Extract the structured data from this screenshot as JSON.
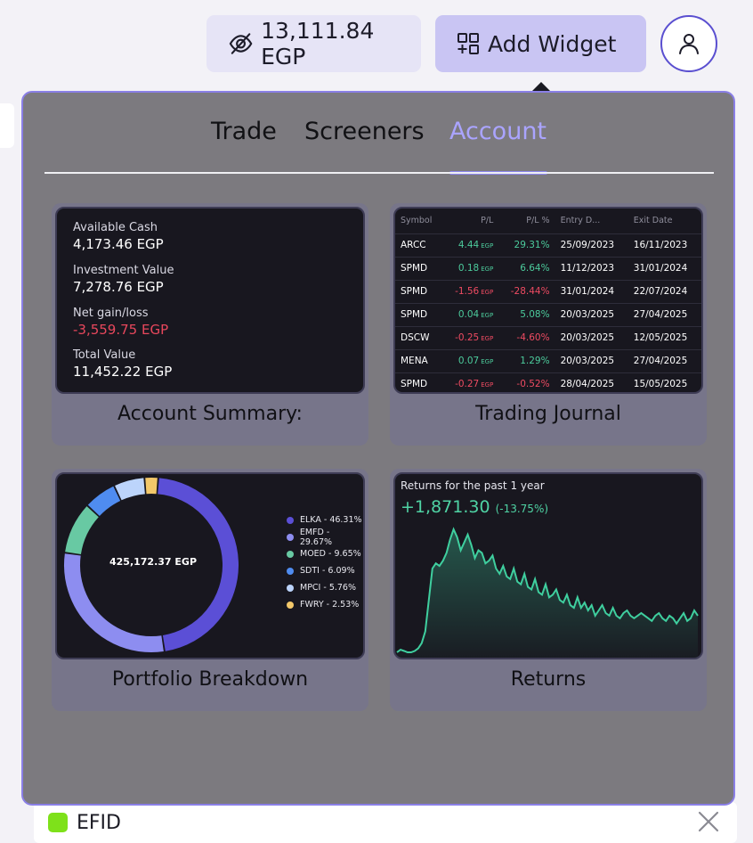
{
  "header": {
    "balance": "13,111.84 EGP",
    "add_widget_label": "Add Widget"
  },
  "tabs": [
    {
      "label": "Trade",
      "active": false
    },
    {
      "label": "Screeners",
      "active": false
    },
    {
      "label": "Account",
      "active": true
    }
  ],
  "widgets": {
    "account_summary": {
      "title": "Account Summary:",
      "rows": [
        {
          "label": "Available Cash",
          "value": "4,173.46 EGP",
          "negative": false
        },
        {
          "label": "Investment Value",
          "value": "7,278.76 EGP",
          "negative": false
        },
        {
          "label": "Net gain/loss",
          "value": "-3,559.75 EGP",
          "negative": true
        },
        {
          "label": "Total Value",
          "value": "11,452.22 EGP",
          "negative": false
        }
      ]
    },
    "trading_journal": {
      "title": "Trading Journal",
      "columns": [
        "Symbol",
        "P/L",
        "P/L %",
        "Entry D...",
        "Exit Date"
      ],
      "currency": "EGP",
      "rows": [
        {
          "symbol": "ARCC",
          "pl": "4.44",
          "pl_pct": "29.31%",
          "entry": "25/09/2023",
          "exit": "16/11/2023",
          "negative": false
        },
        {
          "symbol": "SPMD",
          "pl": "0.18",
          "pl_pct": "6.64%",
          "entry": "11/12/2023",
          "exit": "31/01/2024",
          "negative": false
        },
        {
          "symbol": "SPMD",
          "pl": "-1.56",
          "pl_pct": "-28.44%",
          "entry": "31/01/2024",
          "exit": "22/07/2024",
          "negative": true
        },
        {
          "symbol": "SPMD",
          "pl": "0.04",
          "pl_pct": "5.08%",
          "entry": "20/03/2025",
          "exit": "27/04/2025",
          "negative": false
        },
        {
          "symbol": "DSCW",
          "pl": "-0.25",
          "pl_pct": "-4.60%",
          "entry": "20/03/2025",
          "exit": "12/05/2025",
          "negative": true
        },
        {
          "symbol": "MENA",
          "pl": "0.07",
          "pl_pct": "1.29%",
          "entry": "20/03/2025",
          "exit": "27/04/2025",
          "negative": false
        },
        {
          "symbol": "SPMD",
          "pl": "-0.27",
          "pl_pct": "-0.52%",
          "entry": "28/04/2025",
          "exit": "15/05/2025",
          "negative": true
        }
      ]
    },
    "portfolio_breakdown": {
      "title": "Portfolio Breakdown",
      "total": "425,172.37 EGP",
      "slices": [
        {
          "name": "ELKA - 46.31%",
          "value": 46.31,
          "color": "#5b4fd6"
        },
        {
          "name": "EMFD - 29.67%",
          "value": 29.67,
          "color": "#8d8df0"
        },
        {
          "name": "MOED - 9.65%",
          "value": 9.65,
          "color": "#68c9a3"
        },
        {
          "name": "SDTI - 6.09%",
          "value": 6.09,
          "color": "#4f8cf0"
        },
        {
          "name": "MPCI - 5.76%",
          "value": 5.76,
          "color": "#bcd4fb"
        },
        {
          "name": "FWRY - 2.53%",
          "value": 2.53,
          "color": "#f3c86a"
        }
      ]
    },
    "returns": {
      "title": "Returns",
      "label": "Returns for the past 1 year",
      "value": "+1,871.30",
      "pct": "(-13.75%)",
      "line_color": "#3fcf9f",
      "series": [
        2,
        4,
        3,
        2,
        2,
        3,
        5,
        9,
        18,
        42,
        66,
        70,
        68,
        72,
        78,
        88,
        96,
        90,
        80,
        86,
        92,
        84,
        74,
        80,
        78,
        70,
        72,
        76,
        66,
        62,
        68,
        60,
        58,
        66,
        56,
        54,
        62,
        52,
        50,
        58,
        48,
        46,
        54,
        44,
        46,
        50,
        42,
        40,
        46,
        38,
        36,
        44,
        36,
        40,
        34,
        38,
        30,
        34,
        38,
        32,
        30,
        36,
        30,
        28,
        32,
        34,
        30,
        28,
        30,
        32,
        30,
        28,
        26,
        30,
        32,
        28,
        26,
        30,
        28,
        24,
        28,
        32,
        26,
        28,
        34,
        30
      ]
    }
  },
  "bottom_item": {
    "label": "EFID",
    "dot_color": "#7ee11a"
  }
}
